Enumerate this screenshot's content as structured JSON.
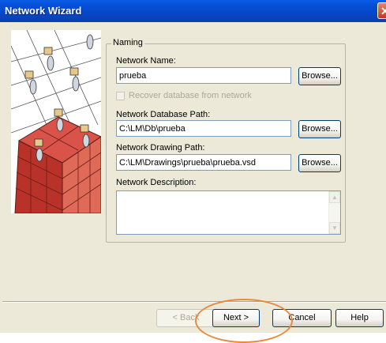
{
  "window": {
    "title": "Network Wizard",
    "close_glyph": "✕"
  },
  "naming": {
    "legend": "Naming",
    "network_name_label": "Network Name:",
    "network_name_value": "prueba",
    "recover_checkbox_label": "Recover database from network",
    "recover_checked": false,
    "database_path_label": "Network Database Path:",
    "database_path_value": "C:\\LM\\Db\\prueba",
    "drawing_path_label": "Network Drawing Path:",
    "drawing_path_value": "C:\\LM\\Drawings\\prueba\\prueba.vsd",
    "description_label": "Network Description:",
    "description_value": "",
    "browse_label": "Browse..."
  },
  "footer": {
    "back_label": "< Back",
    "next_label": "Next >",
    "cancel_label": "Cancel",
    "help_label": "Help"
  },
  "annotation": {
    "highlight_color": "#e88a3c"
  },
  "icons": {
    "close": "close-icon",
    "illustration": "wizard-illustration",
    "scroll_up": "scroll-up-arrow-icon",
    "scroll_down": "scroll-down-arrow-icon"
  }
}
